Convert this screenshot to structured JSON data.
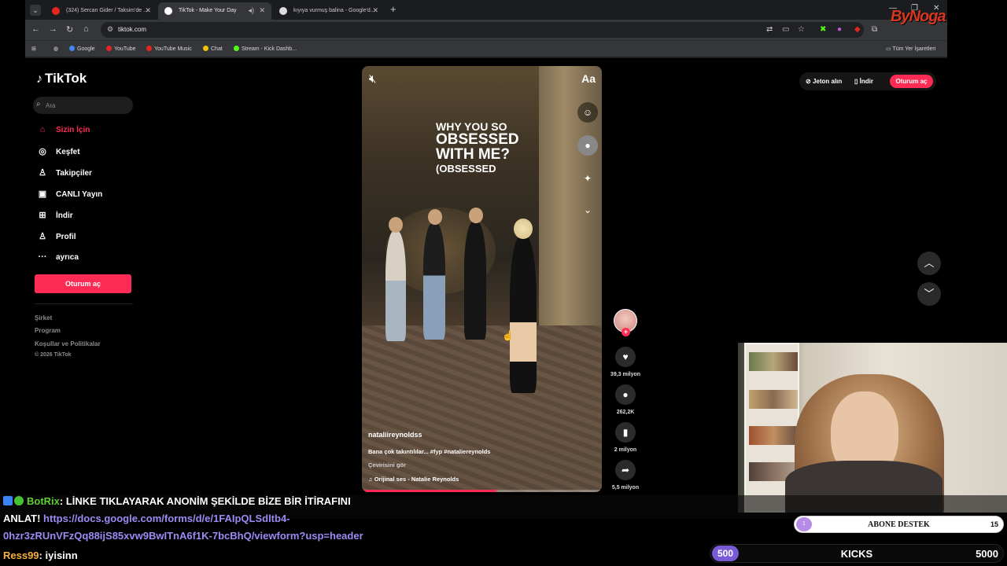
{
  "browser": {
    "tabs": [
      {
        "title": "(324) Sercan Gider / Taksim'de ...",
        "active": false,
        "favicon_color": "#e5261f"
      },
      {
        "title": "TikTok - Make Your Day",
        "active": true,
        "favicon_color": "#ffffff"
      },
      {
        "title": "kıyıya vurmuş balina - Google'd...",
        "active": false,
        "favicon_color": "#dddddd"
      }
    ],
    "url": "tiktok.com",
    "bookmarks": [
      {
        "label": "Google",
        "color": "#4285f4"
      },
      {
        "label": "YouTube",
        "color": "#e5261f"
      },
      {
        "label": "YouTube Music",
        "color": "#e5261f"
      },
      {
        "label": "Chat",
        "color": "#f2c200"
      },
      {
        "label": "Stream - Kick Dashb...",
        "color": "#53fc18"
      }
    ],
    "bookmarks_folder": "Tüm Yer İşaretleri"
  },
  "stream_logo": "ByNoga",
  "tiktok": {
    "logo": "TikTok",
    "search_placeholder": "Ara",
    "nav": [
      {
        "label": "Sizin İçin",
        "icon": "home-icon",
        "active": true
      },
      {
        "label": "Keşfet",
        "icon": "compass-icon",
        "active": false
      },
      {
        "label": "Takipçiler",
        "icon": "followers-icon",
        "active": false
      },
      {
        "label": "CANLI Yayın",
        "icon": "live-icon",
        "active": false
      },
      {
        "label": "İndir",
        "icon": "download-icon",
        "active": false
      },
      {
        "label": "Profil",
        "icon": "profile-icon",
        "active": false
      },
      {
        "label": "ayrıca",
        "icon": "more-icon",
        "active": false
      }
    ],
    "login_label": "Oturum aç",
    "footer_links": [
      "Şirket",
      "Program",
      "Koşullar ve Politikalar"
    ],
    "copyright": "© 2026 TikTok",
    "header": {
      "coins": "Jeton alın",
      "download": "İndir",
      "login": "Oturum aç"
    },
    "video": {
      "caption_lines": [
        "WHY YOU SO",
        "OBSESSED",
        "WITH ME?",
        "(OBSESSED"
      ],
      "username": "nataliireynoldss",
      "description": "Bana çok takıntılılar...  #fyp #nataliereynolds",
      "translate": "Çevirisini gör",
      "music": "Orijinal ses - Natalie Reynolds",
      "progress": 0.56
    },
    "actions": [
      {
        "icon": "heart-icon",
        "count": "39,3 milyon"
      },
      {
        "icon": "comment-icon",
        "count": "262,2K"
      },
      {
        "icon": "bookmark-icon",
        "count": "2 milyon"
      },
      {
        "icon": "share-icon",
        "count": "5,5 milyon"
      }
    ]
  },
  "chat": {
    "bot_user": "BotRix",
    "bot_message": ": LİNKE TIKLAYARAK ANONİM ŞEKİLDE BİZE BİR İTİRAFINI",
    "bot_message_cont": "ANLAT!",
    "link_part1": "https://docs.google.com/forms/d/e/1FAIpQLSdltb4-",
    "link_part2": "0hzr3zRUnVFzQq88ijS85xvw9BwITnA6f1K-7bcBhQ/viewform?usp=header",
    "user2": "Ress99",
    "user2_message": ": iyisinn"
  },
  "goals": {
    "sub_goal": {
      "badge": "1",
      "label": "ABONE DESTEK",
      "target": "15"
    },
    "kicks_goal": {
      "current": "500",
      "label": "KICKS",
      "target": "5000"
    }
  }
}
